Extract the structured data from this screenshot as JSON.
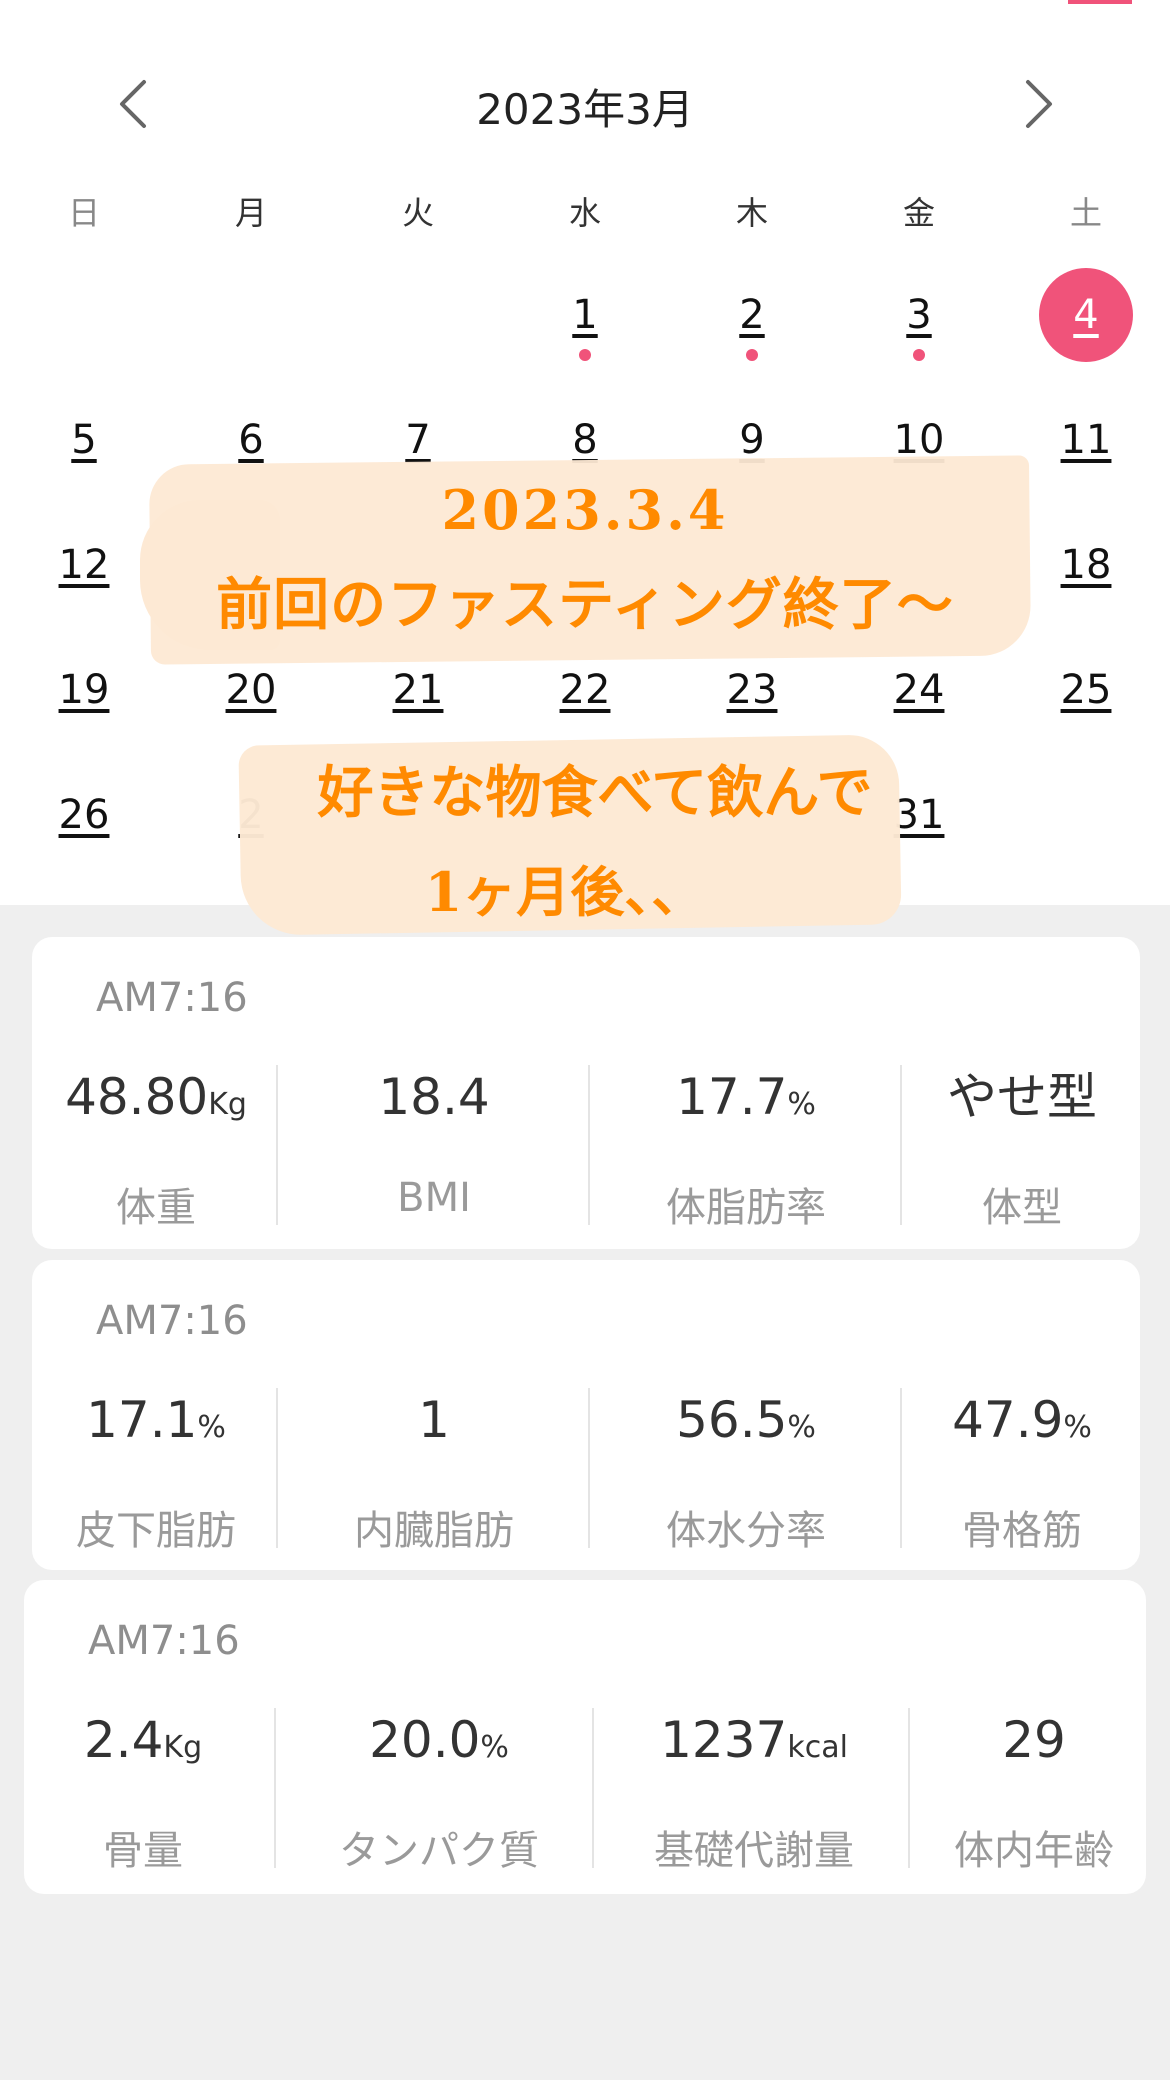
{
  "calendar": {
    "month_label": "2023年3月",
    "weekdays": [
      "日",
      "月",
      "火",
      "水",
      "木",
      "金",
      "土"
    ],
    "days": [
      "1",
      "2",
      "3",
      "4",
      "5",
      "6",
      "7",
      "8",
      "9",
      "10",
      "11",
      "12",
      "18",
      "19",
      "20",
      "21",
      "22",
      "23",
      "24",
      "25",
      "26",
      "2",
      "31"
    ],
    "selected_day": "4",
    "marked_days": [
      "1",
      "2",
      "3"
    ]
  },
  "overlay": {
    "line1": "2023.3.4",
    "line2": "前回のファスティング終了〜",
    "line3": "好きな物食べて飲んで",
    "line4": "1ヶ月後、、"
  },
  "cards": [
    {
      "time": "AM7:16",
      "metrics": [
        {
          "value": "48.80",
          "unit": "Kg",
          "label": "体重"
        },
        {
          "value": "18.4",
          "unit": "",
          "label": "BMI"
        },
        {
          "value": "17.7",
          "unit": "%",
          "label": "体脂肪率"
        },
        {
          "value": "やせ型",
          "unit": "",
          "label": "体型"
        }
      ]
    },
    {
      "time": "AM7:16",
      "metrics": [
        {
          "value": "17.1",
          "unit": "%",
          "label": "皮下脂肪"
        },
        {
          "value": "1",
          "unit": "",
          "label": "内臓脂肪"
        },
        {
          "value": "56.5",
          "unit": "%",
          "label": "体水分率"
        },
        {
          "value": "47.9",
          "unit": "%",
          "label": "骨格筋"
        }
      ]
    },
    {
      "time": "AM7:16",
      "metrics": [
        {
          "value": "2.4",
          "unit": "Kg",
          "label": "骨量"
        },
        {
          "value": "20.0",
          "unit": "%",
          "label": "タンパク質"
        },
        {
          "value": "1237",
          "unit": "kcal",
          "label": "基礎代謝量"
        },
        {
          "value": "29",
          "unit": "",
          "label": "体内年齢"
        }
      ]
    }
  ],
  "colors": {
    "accent": "#f0537a",
    "overlay_text": "#ff8a00",
    "overlay_bg": "#fde9d4",
    "page_bg": "#efefef"
  },
  "icons": {
    "prev": "chevron-left-icon",
    "next": "chevron-right-icon"
  }
}
